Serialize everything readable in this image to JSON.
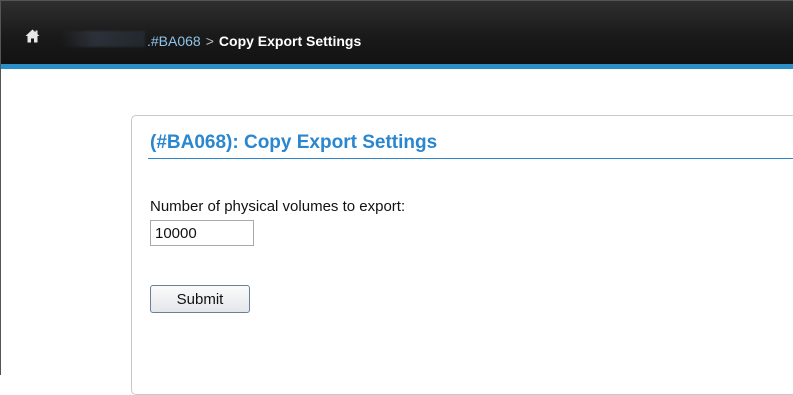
{
  "header": {
    "home_icon": "home-icon",
    "accent_color": "#2a8fc6",
    "breadcrumb": {
      "parent_id": ".#BA068",
      "separator": ">",
      "current": "Copy Export Settings"
    }
  },
  "panel": {
    "title": "(#BA068): Copy Export Settings",
    "title_color": "#2a86cf",
    "field_label": "Number of physical volumes to export:",
    "field_value": "10000",
    "submit_label": "Submit"
  }
}
